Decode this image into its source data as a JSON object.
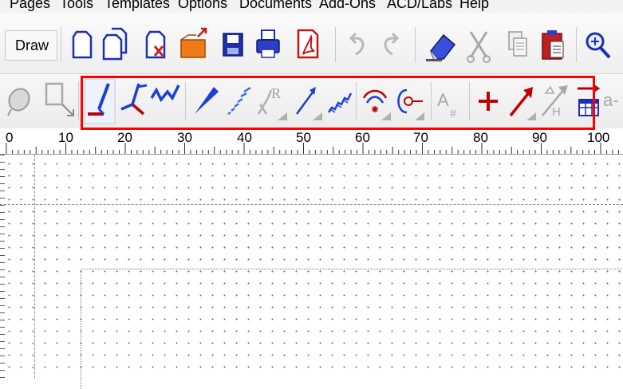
{
  "menu": {
    "items": [
      "Pages",
      "Tools",
      "Templates",
      "Options",
      "Documents",
      "Add-Ons",
      "ACD/Labs",
      "Help"
    ]
  },
  "toolbar1": {
    "draw_label": "Draw",
    "icons": [
      "new-page-icon",
      "duplicate-page-icon",
      "delete-page-icon",
      "open-folder-icon",
      "save-icon",
      "print-icon",
      "pdf-icon",
      "undo-icon",
      "redo-icon",
      "eraser-icon",
      "cut-icon",
      "copy-icon",
      "paste-icon",
      "zoom-icon"
    ]
  },
  "toolbar2": {
    "icons": [
      "lasso-icon",
      "select-icon",
      "single-bond-icon",
      "chain-bond-icon",
      "zigzag-chain-icon",
      "wedge-bond-icon",
      "hashed-wedge-icon",
      "r-group-icon",
      "arrow-icon",
      "wavy-bond-icon",
      "ring-charge-icon",
      "atom-map-icon",
      "atom-label-icon",
      "plus-charge-icon",
      "reaction-arrow-icon",
      "implicit-h-icon",
      "table-icon"
    ],
    "atom_label_glyph": "A",
    "atom_label_sub": "#",
    "r_group_glyph": "R",
    "implicit_h_glyph": "H",
    "trailing_text": "a-"
  },
  "ruler": {
    "labels": [
      "0",
      "10",
      "20",
      "30",
      "40",
      "50",
      "60",
      "70",
      "80",
      "90",
      "100"
    ]
  },
  "colors": {
    "highlight": "#ff0000",
    "bond_blue": "#1a3fd6",
    "accent_red": "#c00000"
  }
}
